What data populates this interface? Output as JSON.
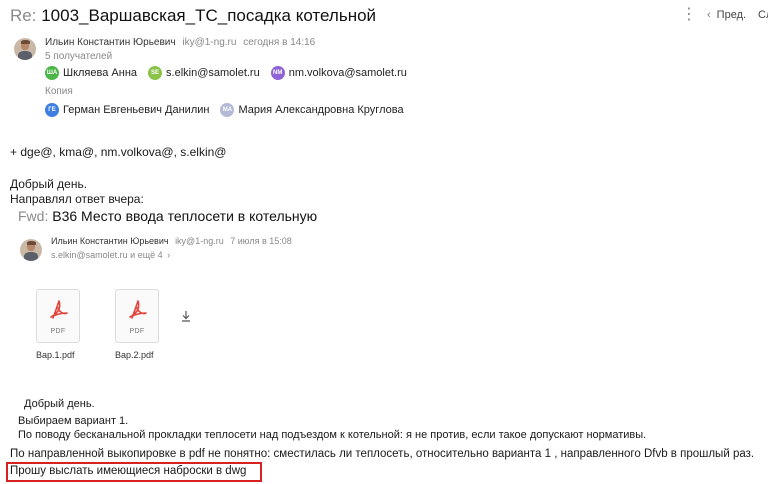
{
  "subject": {
    "prefix": "Re:",
    "text": "1003_Варшавская_ТС_посадка котельной"
  },
  "toolbar": {
    "more": "⋮",
    "prev_label": "Пред.",
    "next_label": "Сл"
  },
  "sender": {
    "name": "Ильин Константин Юрьевич",
    "email": "iky@1-ng.ru",
    "date": "сегодня в 14:16"
  },
  "recipients_count": "5 получателей",
  "to": [
    {
      "initials": "ША",
      "name": "Шкляева Анна",
      "color": "#4cb648"
    },
    {
      "initials": "SE",
      "name": "s.elkin@samolet.ru",
      "color": "#8bc34a"
    },
    {
      "initials": "NM",
      "name": "nm.volkova@samolet.ru",
      "color": "#8e63d8"
    }
  ],
  "copy_label": "Копия",
  "cc": [
    {
      "initials": "ГЕ",
      "name": "Герман Евгеньевич Данилин",
      "color": "#3f7fe0"
    },
    {
      "initials": "МА",
      "name": "Мария Александровна Круглова",
      "color": "#b4bad6"
    }
  ],
  "body": {
    "line1": "+ dge@, kma@, nm.volkova@, s.elkin@",
    "line2": "Добрый день.",
    "line3": "Направлял ответ вчера:"
  },
  "quoted": {
    "fwd_prefix": "Fwd:",
    "fwd_subject": "В36 Место ввода теплосети в котельную",
    "sender_name": "Ильин Константин Юрьевич",
    "sender_email": "iky@1-ng.ru",
    "date": "7 июля в 15:08",
    "recipients": "s.elkin@samolet.ru и ещё 4",
    "attachments": [
      {
        "ext": "PDF",
        "name": "Вар.1.pdf"
      },
      {
        "ext": "PDF",
        "name": "Вар.2.pdf"
      }
    ],
    "greeting": "Добрый день.",
    "variant": "Выбираем вариант 1.",
    "note": "По поводу бесканальной прокладки теплосети над подъездом к котельной: я не против, если такое допускают нормативы."
  },
  "closing": {
    "line1": "По направленной выкопировке в pdf не понятно: сместилась ли теплосеть, относительно варианта 1 , направленного Dfvb в прошлый раз.",
    "line2": "Прошу выслать имеющиеся наброски в dwg"
  },
  "colors": {
    "highlight": "#d9211f",
    "pdf_red": "#e2433b"
  },
  "icons": [
    "chevron-left-icon",
    "more-vertical-icon",
    "pdf-icon",
    "download-icon",
    "chevron-right-icon"
  ]
}
